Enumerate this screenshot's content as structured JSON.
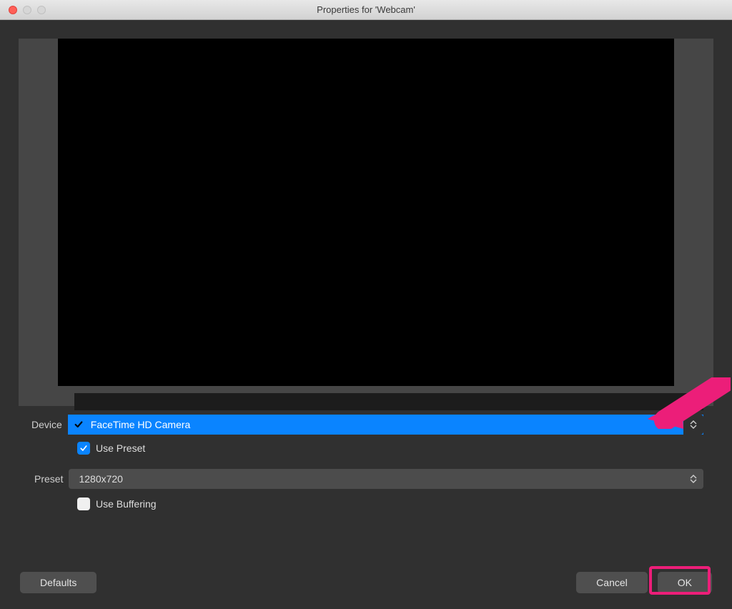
{
  "window": {
    "title": "Properties for 'Webcam'"
  },
  "form": {
    "device_label": "Device",
    "device_value": "FaceTime HD Camera",
    "use_preset_label": "Use Preset",
    "use_preset_checked": true,
    "preset_label": "Preset",
    "preset_value": "1280x720",
    "use_buffering_label": "Use Buffering",
    "use_buffering_checked": false
  },
  "buttons": {
    "defaults": "Defaults",
    "cancel": "Cancel",
    "ok": "OK"
  },
  "annotation": {
    "arrow_color": "#ec1e79"
  }
}
